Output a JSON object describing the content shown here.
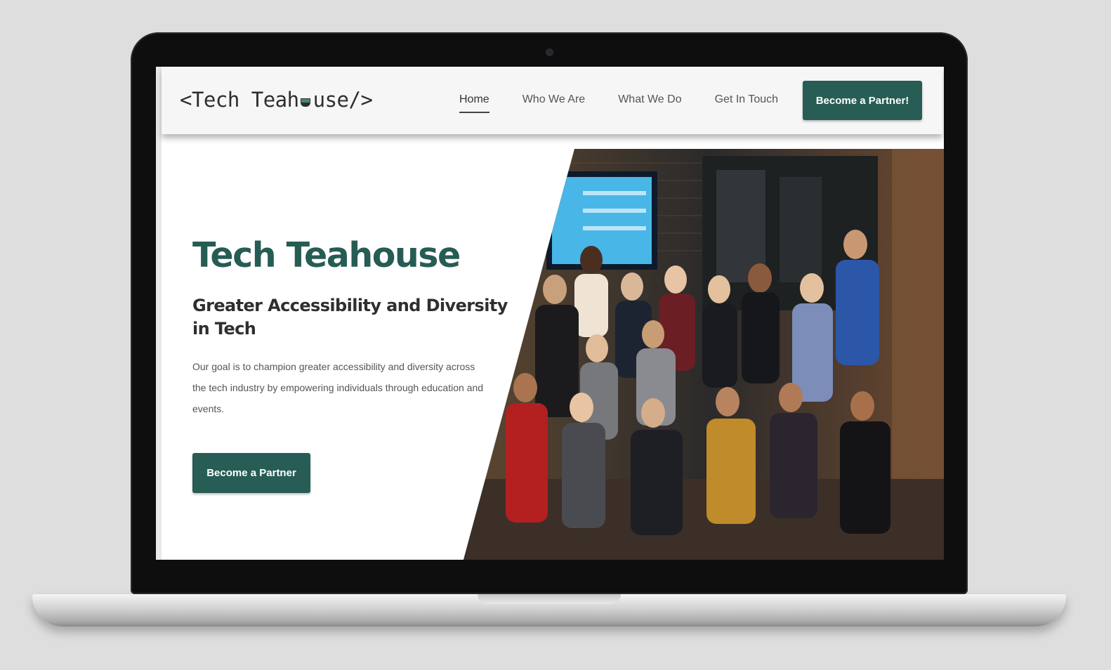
{
  "header": {
    "logo_text_before": "<Tech Teah",
    "logo_text_after": "use/>",
    "logo_icon": "teacup-icon",
    "nav": [
      {
        "label": "Home",
        "active": true
      },
      {
        "label": "Who We Are",
        "active": false
      },
      {
        "label": "What We Do",
        "active": false
      },
      {
        "label": "Get In Touch",
        "active": false
      }
    ],
    "cta_label": "Become a Partner!"
  },
  "hero": {
    "title": "Tech Teahouse",
    "subtitle": "Greater Accessibility and Diversity in Tech",
    "body": "Our goal is to champion greater accessibility and diversity across the tech industry by empowering individuals through education and events.",
    "cta_label": "Become a Partner"
  },
  "colors": {
    "brand_green": "#275d55",
    "page_background": "#dedede"
  }
}
